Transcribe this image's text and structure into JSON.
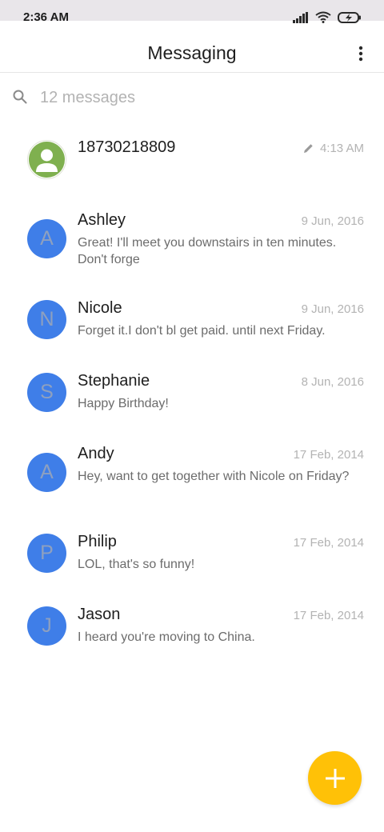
{
  "status_bar": {
    "time": "2:36 AM"
  },
  "app_bar": {
    "title": "Messaging"
  },
  "search": {
    "placeholder": "12 messages"
  },
  "conversations": [
    {
      "avatar_type": "contact",
      "name": "18730218809",
      "time": "4:13 AM",
      "draft": true,
      "snippet": ""
    },
    {
      "avatar_type": "letter",
      "initial": "A",
      "name": "Ashley",
      "time": "9 Jun, 2016",
      "snippet": "Great! I'll meet you downstairs in ten minutes. Don't forge"
    },
    {
      "avatar_type": "letter",
      "initial": "N",
      "name": "Nicole",
      "time": "9 Jun, 2016",
      "snippet": "Forget it.I don't bl get paid. until next Friday."
    },
    {
      "avatar_type": "letter",
      "initial": "S",
      "name": "Stephanie",
      "time": "8 Jun, 2016",
      "snippet": "Happy Birthday!"
    },
    {
      "avatar_type": "letter",
      "initial": "A",
      "name": "Andy",
      "time": "17 Feb, 2014",
      "snippet": "Hey, want to get together with Nicole on Friday?"
    },
    {
      "avatar_type": "letter",
      "initial": "P",
      "name": "Philip",
      "time": "17 Feb, 2014",
      "snippet": "LOL, that's so funny!"
    },
    {
      "avatar_type": "letter",
      "initial": "J",
      "name": "Jason",
      "time": "17 Feb, 2014",
      "snippet": "I heard you're moving to China."
    }
  ],
  "colors": {
    "avatar_blue": "#3f7ee8",
    "contact_green": "#7fb04f",
    "fab_yellow": "#ffc107"
  },
  "icons": {
    "status": [
      "signal-icon",
      "wifi-icon",
      "battery-icon"
    ],
    "app_bar": "more-vert-icon",
    "search": "search-icon",
    "draft": "pencil-icon",
    "fab": "plus-icon"
  }
}
